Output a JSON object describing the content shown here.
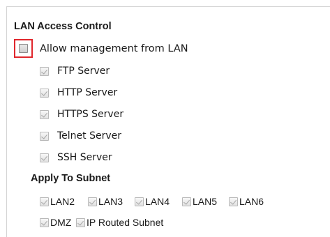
{
  "section": {
    "title": "LAN Access Control"
  },
  "allow": {
    "label": "Allow management from LAN",
    "checked": false
  },
  "servers": [
    {
      "label": "FTP Server",
      "checked": true,
      "disabled": true
    },
    {
      "label": "HTTP Server",
      "checked": true,
      "disabled": true
    },
    {
      "label": "HTTPS Server",
      "checked": true,
      "disabled": true
    },
    {
      "label": "Telnet Server",
      "checked": true,
      "disabled": true
    },
    {
      "label": "SSH Server",
      "checked": true,
      "disabled": true
    }
  ],
  "subnet": {
    "title": "Apply To Subnet",
    "row1": [
      {
        "label": "LAN2",
        "checked": true
      },
      {
        "label": "LAN3",
        "checked": true
      },
      {
        "label": "LAN4",
        "checked": true
      },
      {
        "label": "LAN5",
        "checked": true
      },
      {
        "label": "LAN6",
        "checked": true
      }
    ],
    "row2": [
      {
        "label": "DMZ",
        "checked": true
      },
      {
        "label": "IP Routed Subnet",
        "checked": true
      }
    ]
  },
  "colors": {
    "highlight": "#e0262c"
  }
}
